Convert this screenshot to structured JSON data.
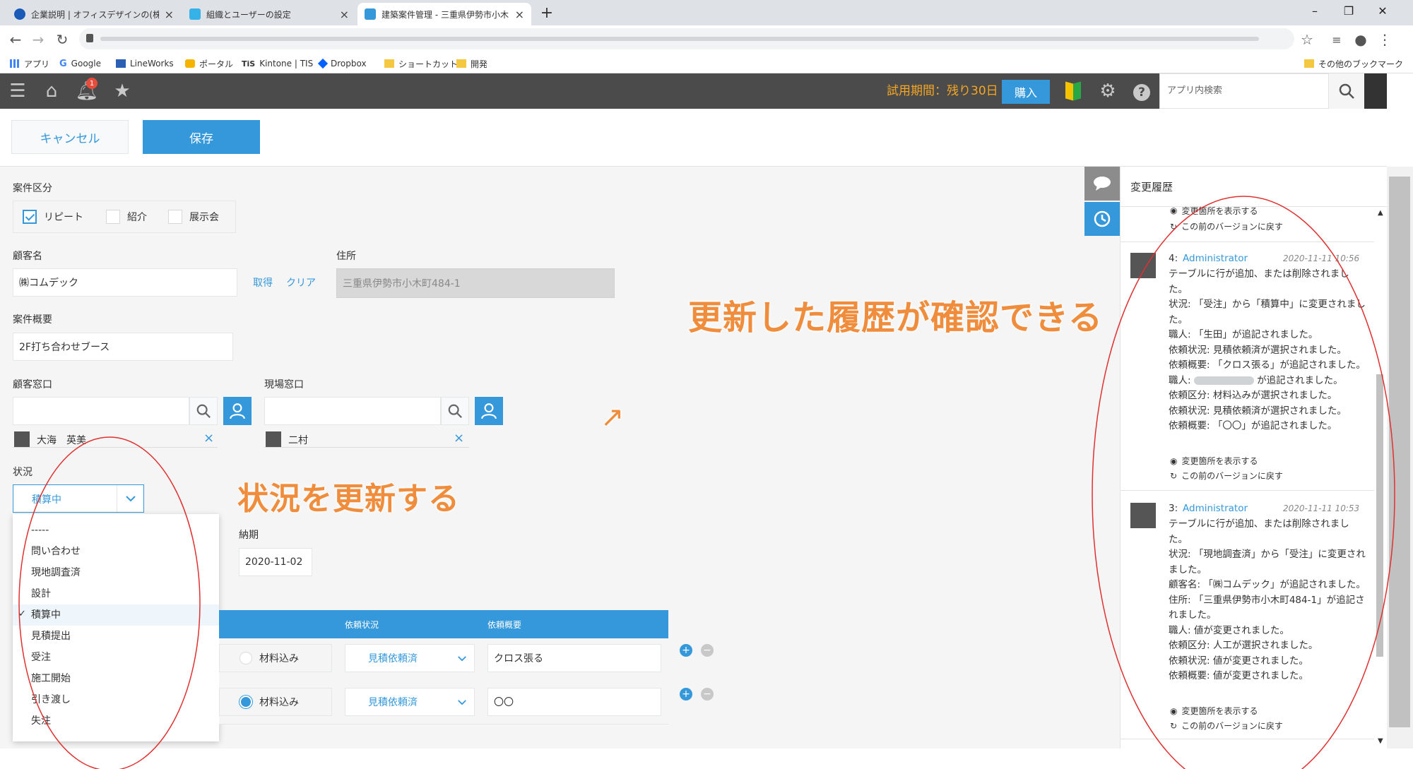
{
  "browser": {
    "tabs": [
      {
        "title": "企業説明 | オフィスデザインの(株)スラ"
      },
      {
        "title": "組織とユーザーの設定"
      },
      {
        "title": "建築案件管理 - 三重県伊勢市小木"
      }
    ],
    "new_tab": "+",
    "window_controls": {
      "minimize": "–",
      "restore": "❐",
      "close": "✕"
    },
    "bookmarks": [
      "アプリ",
      "Google",
      "LineWorks",
      "ポータル",
      "Kintone | TIS",
      "Dropbox",
      "ショートカット",
      "開発"
    ],
    "other_bookmarks": "その他のブックマーク"
  },
  "header": {
    "notification_count": "1",
    "trial_text": "試用期間：残り30日",
    "buy_label": "購入",
    "search_placeholder": "アプリ内検索"
  },
  "actions": {
    "cancel_label": "キャンセル",
    "save_label": "保存"
  },
  "form": {
    "category": {
      "label": "案件区分",
      "options": [
        {
          "label": "リピート",
          "checked": true
        },
        {
          "label": "紹介",
          "checked": false
        },
        {
          "label": "展示会",
          "checked": false
        }
      ]
    },
    "customer": {
      "label": "顧客名",
      "value": "㈱コムデック",
      "get_label": "取得",
      "clear_label": "クリア"
    },
    "address": {
      "label": "住所",
      "value": "三重県伊勢市小木町484-1"
    },
    "summary": {
      "label": "案件概要",
      "value": "2F打ち合わせブース"
    },
    "customer_contact": {
      "label": "顧客窓口",
      "user": "大海　英美"
    },
    "site_contact": {
      "label": "現場窓口",
      "user": "二村"
    },
    "status": {
      "label": "状況",
      "value": "積算中",
      "options": [
        "-----",
        "問い合わせ",
        "現地調査済",
        "設計",
        "積算中",
        "見積提出",
        "受注",
        "施工開始",
        "引き渡し",
        "失注"
      ],
      "selected_index": 4
    },
    "delivery": {
      "label": "納期",
      "value": "2020-11-02"
    },
    "table": {
      "headers": [
        "依頼状況",
        "依頼概要"
      ],
      "rows": [
        {
          "radio_label": "材料込み",
          "radio_checked": false,
          "request_status": "見積依頼済",
          "request_summary": "クロス張る"
        },
        {
          "radio_label": "材料込み",
          "radio_checked": true,
          "request_status": "見積依頼済",
          "request_summary": "〇〇"
        }
      ]
    }
  },
  "annotations": {
    "status_note": "状況を更新する",
    "history_note": "更新した履歴が確認できる",
    "arrow": "↗"
  },
  "history": {
    "title": "変更履歴",
    "show_changes_label": "変更箇所を表示する",
    "revert_label": "この前のバージョンに戻す",
    "entries": [
      {
        "version": "4:",
        "user": "Administrator",
        "date": "2020-11-11 10:56",
        "lines": [
          "テーブルに行が追加、または削除されました。",
          "状況: 「受注」から「積算中」に変更されました。",
          "職人: 「生田」が追記されました。",
          "依頼状況: 見積依頼済が選択されました。",
          "依頼概要: 「クロス張る」が追記されました。",
          "が追記されました。",
          "依頼区分: 材料込みが選択されました。",
          "依頼状況: 見積依頼済が選択されました。",
          "依頼概要: 「〇〇」が追記されました。"
        ],
        "line6_prefix": "職人:"
      },
      {
        "version": "3:",
        "user": "Administrator",
        "date": "2020-11-11 10:53",
        "lines": [
          "テーブルに行が追加、または削除されました。",
          "状況: 「現地調査済」から「受注」に変更されました。",
          "顧客名: 「㈱コムデック」が追記されました。",
          "住所: 「三重県伊勢市小木町484-1」が追記されました。",
          "職人: 値が変更されました。",
          "依頼区分: 人工が選択されました。",
          "依頼状況: 値が変更されました。",
          "依頼概要: 値が変更されました。"
        ]
      }
    ]
  },
  "colors": {
    "accent": "#3498db",
    "annotation": "#f08d3c",
    "trial": "#f5a623",
    "header_bg": "#4b4b4b",
    "circle": "#e03030"
  }
}
